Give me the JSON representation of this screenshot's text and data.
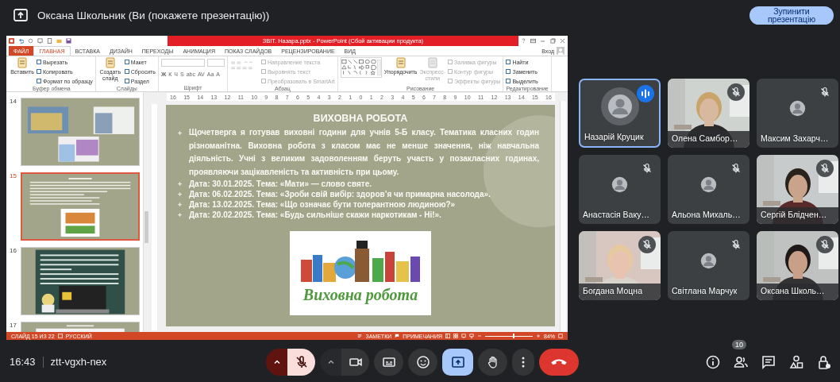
{
  "header": {
    "title": "Оксана Школьник (Ви (покажете презентацію))",
    "stop_button": "Зупинити презентацію"
  },
  "powerpoint": {
    "title": "ЗВІТ. Назара.pptx - PowerPoint (Сбой активации продукта)",
    "tabs": [
      {
        "label": "ФАЙЛ",
        "kind": "file",
        "selected": false
      },
      {
        "label": "ГЛАВНАЯ",
        "kind": "tab",
        "selected": true
      },
      {
        "label": "ВСТАВКА",
        "kind": "tab",
        "selected": false
      },
      {
        "label": "ДИЗАЙН",
        "kind": "tab",
        "selected": false
      },
      {
        "label": "ПЕРЕХОДЫ",
        "kind": "tab",
        "selected": false
      },
      {
        "label": "АНИМАЦИЯ",
        "kind": "tab",
        "selected": false
      },
      {
        "label": "ПОКАЗ СЛАЙДОВ",
        "kind": "tab",
        "selected": false
      },
      {
        "label": "РЕЦЕНЗИРОВАНИЕ",
        "kind": "tab",
        "selected": false
      },
      {
        "label": "ВИД",
        "kind": "tab",
        "selected": false
      }
    ],
    "sign_in": "Вход",
    "ribbon": [
      {
        "label": "Буфер обмена",
        "items": [
          {
            "kind": "large",
            "label": "Вставить",
            "disabled": false
          },
          {
            "kind": "small",
            "label": "Вырезать",
            "disabled": false
          },
          {
            "kind": "small",
            "label": "Копировать",
            "disabled": false
          },
          {
            "kind": "small",
            "label": "Формат по образцу",
            "disabled": false
          }
        ]
      },
      {
        "label": "Слайды",
        "items": [
          {
            "kind": "large",
            "label": "Создать слайд",
            "disabled": false
          },
          {
            "kind": "small",
            "label": "Макет",
            "disabled": false
          },
          {
            "kind": "small",
            "label": "Сбросить",
            "disabled": false
          },
          {
            "kind": "small",
            "label": "Раздел",
            "disabled": false
          }
        ]
      },
      {
        "label": "Шрифт",
        "items": [
          {
            "kind": "font",
            "glyphs": [
              "Ж",
              "К",
              "Ч",
              "S",
              "abc",
              "AV",
              "Aa",
              "A"
            ]
          }
        ]
      },
      {
        "label": "Абзац",
        "items": [
          {
            "kind": "paragraph"
          },
          {
            "kind": "small",
            "label": "Направление текста",
            "disabled": true
          },
          {
            "kind": "small",
            "label": "Выровнять текст",
            "disabled": true
          },
          {
            "kind": "small",
            "label": "Преобразовать в SmartArt",
            "disabled": true
          }
        ]
      },
      {
        "label": "Рисование",
        "items": [
          {
            "kind": "shapes"
          },
          {
            "kind": "large",
            "label": "Упорядочить",
            "disabled": false
          },
          {
            "kind": "large",
            "label": "Экспресс-стили",
            "disabled": true
          },
          {
            "kind": "small",
            "label": "Заливка фигуры",
            "disabled": true
          },
          {
            "kind": "small",
            "label": "Контур фигуры",
            "disabled": true
          },
          {
            "kind": "small",
            "label": "Эффекты фигуры",
            "disabled": true
          }
        ]
      },
      {
        "label": "Редактирование",
        "items": [
          {
            "kind": "small",
            "label": "Найти",
            "disabled": false
          },
          {
            "kind": "small",
            "label": "Заменить",
            "disabled": false
          },
          {
            "kind": "small",
            "label": "Выделить",
            "disabled": false
          }
        ]
      }
    ],
    "ruler": [
      "16",
      "15",
      "14",
      "13",
      "12",
      "11",
      "10",
      "9",
      "8",
      "7",
      "6",
      "5",
      "4",
      "3",
      "2",
      "1",
      "0",
      "1",
      "2",
      "3",
      "4",
      "5",
      "6",
      "7",
      "8",
      "9",
      "10",
      "11",
      "12",
      "13",
      "14",
      "15",
      "16"
    ],
    "thumbnails": [
      {
        "number": "14",
        "kind": "collage",
        "selected": false
      },
      {
        "number": "15",
        "kind": "text",
        "selected": true
      },
      {
        "number": "16",
        "kind": "board",
        "selected": false
      },
      {
        "number": "17",
        "kind": "cut",
        "selected": false
      }
    ],
    "slide": {
      "title": "ВИХОВНА РОБОТА",
      "bullets": [
        "Щочетверга я готував виховні години для учнів 5-Б класу. Тематика класних годин різноманітна. Виховна робота з класом має не менше значення, ніж навчальна діяльність. Учні з великим задоволенням беруть участь у позакласних годинах, проявляючи зацікавленість та активність при цьому.",
        "Дата: 30.01.2025. Тема: «Мати» — слово святе.",
        "Дата: 06.02.2025. Тема: «Зроби свій вибір: здоров’я чи примарна насолода».",
        "Дата: 13.02.2025. Тема: «Що означає бути толерантною людиною?»",
        "Дата: 20.02.2025. Тема: «Будь сильніше скажи наркотикам - Ні!»."
      ],
      "image_caption": "Виховна робота"
    },
    "status": {
      "slide": "СЛАЙД 15 ИЗ 22",
      "language": "РУССКИЙ",
      "notes": "ЗАМЕТКИ",
      "comments": "ПРИМЕЧАНИЯ",
      "zoom": "84%",
      "level": 0.6
    }
  },
  "participants": [
    {
      "name": "Назарій Круцик",
      "kind": "avatar",
      "muted": false,
      "speaking": true
    },
    {
      "name": "Олена Самбор…",
      "kind": "video",
      "muted": true,
      "speaking": false
    },
    {
      "name": "Максим Захарч…",
      "kind": "avatar",
      "muted": true,
      "speaking": false
    },
    {
      "name": "Анастасія Ваку…",
      "kind": "avatar",
      "muted": true,
      "speaking": false
    },
    {
      "name": "Альона Михаль…",
      "kind": "avatar",
      "muted": true,
      "speaking": false
    },
    {
      "name": "Сергій Блідчен…",
      "kind": "video",
      "muted": true,
      "speaking": false
    },
    {
      "name": "Богдана Моцна",
      "kind": "video",
      "muted": true,
      "speaking": false
    },
    {
      "name": "Світлана Марчук",
      "kind": "avatar",
      "muted": true,
      "speaking": false
    },
    {
      "name": "Оксана Школь…",
      "kind": "video",
      "muted": true,
      "speaking": false
    }
  ],
  "footer": {
    "time": "16:43",
    "code": "ztt-vgxh-nex",
    "controls": [
      {
        "kind": "mic",
        "muted": true
      },
      {
        "kind": "camera"
      },
      {
        "kind": "captions"
      },
      {
        "kind": "reactions"
      },
      {
        "kind": "present",
        "selected": true
      },
      {
        "kind": "hand"
      },
      {
        "kind": "more"
      },
      {
        "kind": "end"
      }
    ],
    "side": [
      {
        "kind": "info"
      },
      {
        "kind": "people",
        "badge": "10"
      },
      {
        "kind": "chat"
      },
      {
        "kind": "activities"
      },
      {
        "kind": "host"
      }
    ]
  }
}
